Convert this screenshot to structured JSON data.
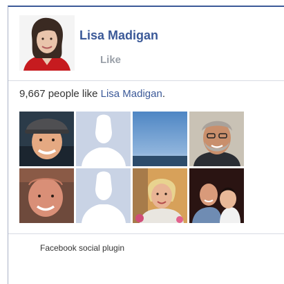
{
  "page": {
    "name": "Lisa Madigan",
    "like_label": "Like"
  },
  "stats": {
    "count": "9,667",
    "text": " people like ",
    "page_link": "Lisa Madigan",
    "end": "."
  },
  "faces": [
    {
      "kind": "photo",
      "icon": "face-photo-hat"
    },
    {
      "kind": "placeholder",
      "icon": "default-avatar-icon"
    },
    {
      "kind": "photo",
      "icon": "face-photo-sky"
    },
    {
      "kind": "photo",
      "icon": "face-photo-beard"
    },
    {
      "kind": "photo",
      "icon": "face-photo-bald"
    },
    {
      "kind": "placeholder",
      "icon": "default-avatar-icon"
    },
    {
      "kind": "photo",
      "icon": "face-photo-woman"
    },
    {
      "kind": "photo",
      "icon": "face-photo-child"
    }
  ],
  "footer": {
    "label": "Facebook social plugin"
  },
  "colors": {
    "brand": "#3b5998",
    "placeholder_bg": "#c9d3e5",
    "divider": "#d8dbe3"
  }
}
